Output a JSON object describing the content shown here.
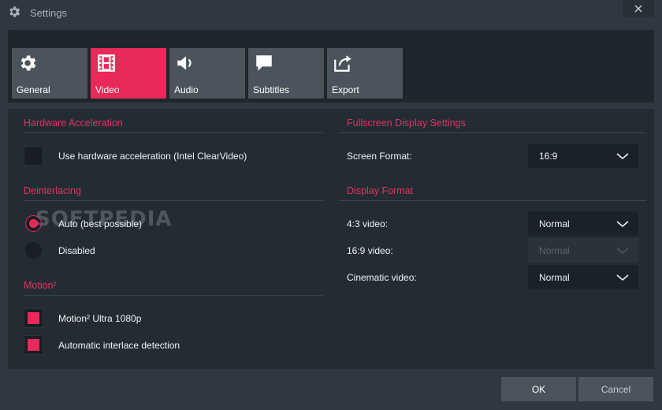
{
  "window": {
    "title": "Settings"
  },
  "tabs": [
    {
      "label": "General",
      "icon": "gear-icon"
    },
    {
      "label": "Video",
      "icon": "film-icon",
      "active": true
    },
    {
      "label": "Audio",
      "icon": "speaker-icon"
    },
    {
      "label": "Subtitles",
      "icon": "speech-bubble-icon"
    },
    {
      "label": "Export",
      "icon": "export-icon"
    }
  ],
  "hardware": {
    "title": "Hardware Acceleration",
    "checkbox_label": "Use hardware acceleration (Intel ClearVideo)",
    "checked": false
  },
  "deinterlacing": {
    "title": "Deinterlacing",
    "options": [
      {
        "label": "Auto (best possible)",
        "selected": true
      },
      {
        "label": "Disabled",
        "selected": false
      }
    ]
  },
  "motion": {
    "title": "Motion²",
    "options": [
      {
        "label": "Motion²  Ultra 1080p",
        "checked": true
      },
      {
        "label": "Automatic interlace detection",
        "checked": true
      }
    ]
  },
  "fullscreen": {
    "title": "Fullscreen Display Settings",
    "screen_format_label": "Screen Format:",
    "screen_format_value": "16:9"
  },
  "display_format": {
    "title": "Display Format",
    "rows": [
      {
        "label": "4:3 video:",
        "value": "Normal",
        "enabled": true
      },
      {
        "label": "16:9 video:",
        "value": "Normal",
        "enabled": false
      },
      {
        "label": "Cinematic video:",
        "value": "Normal",
        "enabled": true
      }
    ]
  },
  "watermark": "SOFTPEDIA",
  "buttons": {
    "ok": "OK",
    "cancel": "Cancel"
  },
  "colors": {
    "accent": "#e8295a",
    "background": "#2f3840",
    "panel": "#242c33",
    "tab": "#4b545c"
  }
}
